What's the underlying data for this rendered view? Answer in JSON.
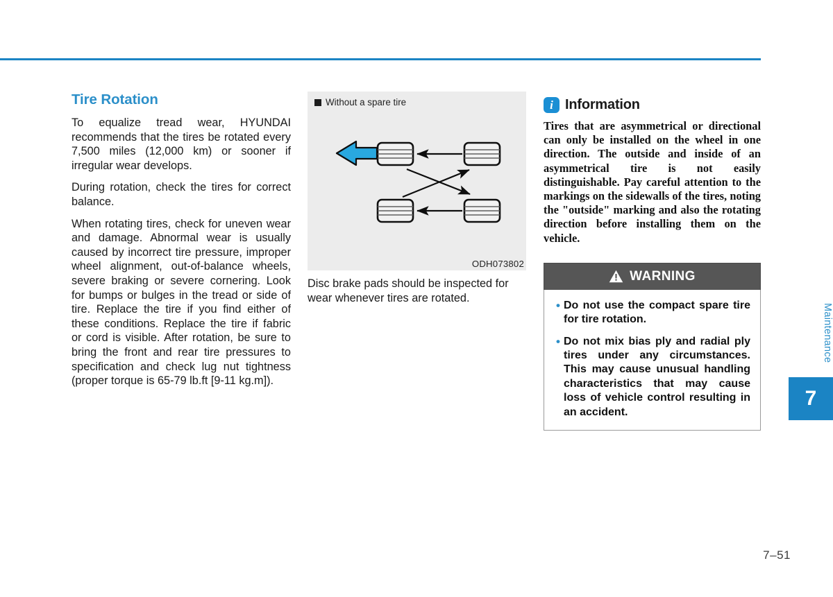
{
  "page": {
    "number": "7–51",
    "chapter_label": "Maintenance",
    "chapter_number": "7"
  },
  "left_column": {
    "title": "Tire Rotation",
    "paragraphs": [
      "To equalize tread wear, HYUNDAI recommends that the tires be rotated every 7,500 miles (12,000 km) or sooner if irregular wear develops.",
      "During rotation, check the tires for correct balance.",
      "When rotating tires, check for uneven wear and damage. Abnormal wear is usually caused by incorrect tire pressure, improper wheel alignment, out-of-balance wheels, severe braking or severe cornering. Look for bumps or bulges in the tread or side of tire. Replace the tire if you find either of these conditions. Replace the tire if fabric or cord is visible. After rotation, be sure to bring the front and rear tire pressures to specification and check lug nut tightness (proper torque is 65-79 lb.ft [9-11 kg.m])."
    ]
  },
  "figure": {
    "label": "Without a spare tire",
    "code": "ODH073802",
    "caption": "Disc brake pads should be inspected for wear whenever tires are rotated.",
    "background_color": "#ececec",
    "direction_arrow_color": "#29a8e0",
    "diagram_description": "Four tires arranged in two rows; front tires on the left, rear tires on the right; straight arrows move rear tires forward on the same side and crossed arrows swap the diagonal positions."
  },
  "information": {
    "icon": "info-icon",
    "title": "Information",
    "body": "Tires that are asymmetrical or directional can only be installed on the wheel in one direction. The outside and inside of an asymmetrical tire is not easily distinguishable. Pay careful attention to the markings on the sidewalls of the tires, noting the \"outside\" marking and also the rotating direction before installing them on the vehicle."
  },
  "warning": {
    "icon": "warning-triangle-icon",
    "title": "WARNING",
    "header_color": "#565656",
    "bullet_color": "#2b8fc9",
    "items": [
      "Do not use the compact spare tire for tire rotation.",
      "Do not mix bias ply and radial ply tires under any circumstances. This may cause unusual handling characteristics that may cause loss of vehicle control resulting in an accident."
    ]
  },
  "theme": {
    "accent_blue": "#2b8fc9",
    "rule_blue": "#1b84c4"
  }
}
